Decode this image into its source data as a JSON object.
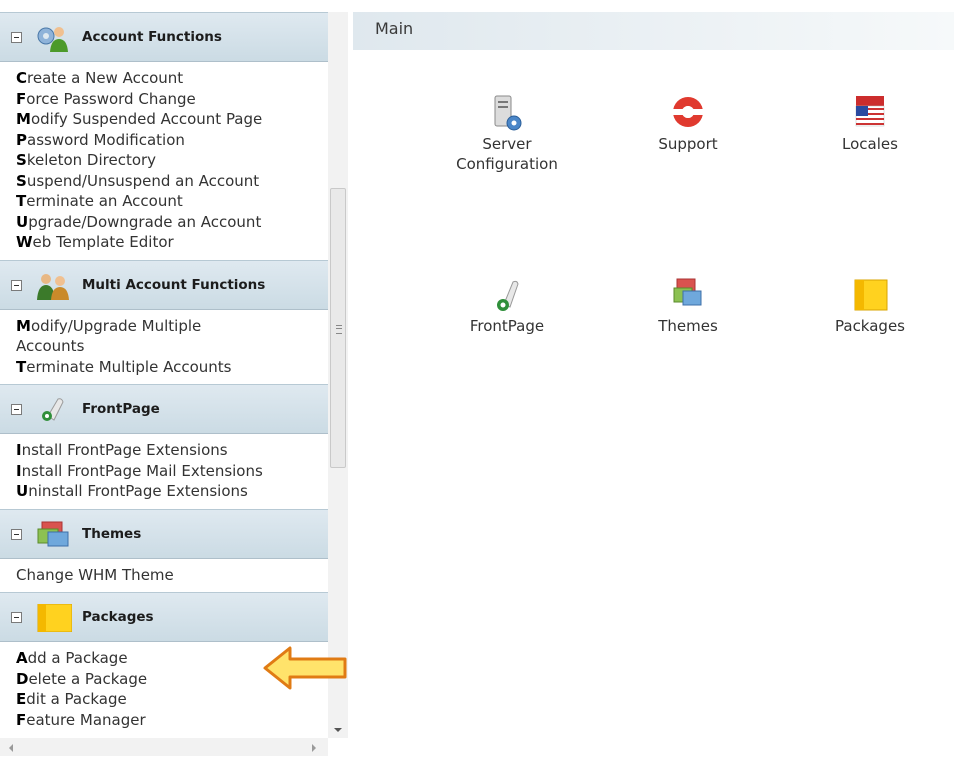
{
  "sidebar": {
    "sections": [
      {
        "title": "Account Functions",
        "icon": "account-users-gear-icon",
        "links": [
          {
            "first": "C",
            "rest": "reate a New Account"
          },
          {
            "first": "F",
            "rest": "orce Password Change"
          },
          {
            "first": "M",
            "rest": "odify Suspended Account Page"
          },
          {
            "first": "P",
            "rest": "assword Modification"
          },
          {
            "first": "S",
            "rest": "keleton Directory"
          },
          {
            "first": "S",
            "rest": "uspend/Unsuspend an Account"
          },
          {
            "first": "T",
            "rest": "erminate an Account"
          },
          {
            "first": "U",
            "rest": "pgrade/Downgrade an Account"
          },
          {
            "first": "W",
            "rest": "eb Template Editor"
          }
        ]
      },
      {
        "title": "Multi Account Functions",
        "icon": "multi-users-icon",
        "links": [
          {
            "first": "M",
            "rest": "odify/Upgrade Multiple"
          },
          {
            "first": "",
            "rest": "Accounts"
          },
          {
            "first": "T",
            "rest": "erminate Multiple Accounts"
          }
        ]
      },
      {
        "title": "FrontPage",
        "icon": "frontpage-icon",
        "links": [
          {
            "first": "I",
            "rest": "nstall FrontPage Extensions"
          },
          {
            "first": "I",
            "rest": "nstall FrontPage Mail Extensions"
          },
          {
            "first": "U",
            "rest": "ninstall FrontPage Extensions"
          }
        ]
      },
      {
        "title": "Themes",
        "icon": "themes-windows-icon",
        "links": [
          {
            "first": "",
            "rest": "Change WHM Theme"
          }
        ]
      },
      {
        "title": "Packages",
        "icon": "packages-box-icon",
        "links": [
          {
            "first": "A",
            "rest": "dd a Package"
          },
          {
            "first": "D",
            "rest": "elete a Package"
          },
          {
            "first": "E",
            "rest": "dit a Package"
          },
          {
            "first": "F",
            "rest": "eature Manager"
          }
        ]
      }
    ]
  },
  "main": {
    "title": "Main",
    "tiles": [
      {
        "label1": "Server",
        "label2": "Configuration",
        "icon": "server-configuration-icon"
      },
      {
        "label1": "Support",
        "label2": "",
        "icon": "support-lifebuoy-icon"
      },
      {
        "label1": "Locales",
        "label2": "",
        "icon": "locales-flags-icon"
      },
      {
        "label1": "FrontPage",
        "label2": "",
        "icon": "frontpage-icon"
      },
      {
        "label1": "Themes",
        "label2": "",
        "icon": "themes-windows-icon"
      },
      {
        "label1": "Packages",
        "label2": "",
        "icon": "packages-box-icon"
      }
    ]
  },
  "colors": {
    "section_header_top": "#dfe9f0",
    "section_header_bottom": "#cbdbe4",
    "arrow_fill": "#ffe36b",
    "arrow_stroke": "#e07b14"
  }
}
